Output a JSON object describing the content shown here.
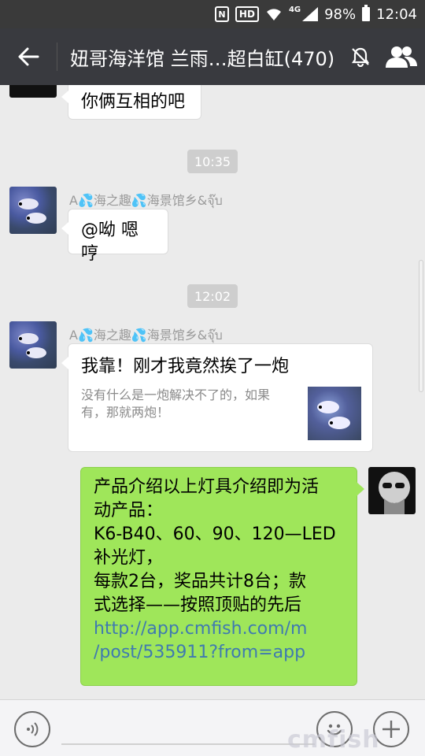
{
  "status_bar": {
    "nfc": "N",
    "hd": "HD",
    "network": "4G",
    "battery": "98%",
    "time": "12:04"
  },
  "header": {
    "title": "妞哥海洋馆 兰雨…超白缸(470)",
    "icons": [
      "back-arrow-icon",
      "mute-bell-icon",
      "members-icon"
    ]
  },
  "messages": [
    {
      "type": "text",
      "side": "left",
      "text": "你俩互相的吧"
    },
    {
      "type": "time",
      "text": "10:35"
    },
    {
      "type": "text",
      "side": "left",
      "sender": "A💦海之趣💦海景馆乡&จุ๊บ",
      "text": "@呦 嗯哼"
    },
    {
      "type": "time",
      "text": "12:02"
    },
    {
      "type": "link",
      "side": "left",
      "sender": "A💦海之趣💦海景馆乡&จุ๊บ",
      "title": "我靠！刚才我竟然挨了一炮",
      "desc_line1": "没有什么是一炮解决不了的，如果",
      "desc_line2": "有，那就两炮！"
    },
    {
      "type": "text",
      "side": "right",
      "lines": [
        "产品介绍以上灯具介绍即为活",
        "动产品：",
        "K6-B40、60、90、120—LED",
        "补光灯，",
        "每款2台，奖品共计8台；款",
        "式选择——按照顶贴的先后"
      ],
      "link_lines": [
        "http://app.cmfish.com/m",
        "/post/535911?from=app"
      ]
    }
  ],
  "input_bar": {
    "icons": [
      "voice-icon",
      "emoji-icon",
      "plus-icon"
    ]
  },
  "watermark": "cmfish",
  "colors": {
    "titlebar": "#393a3f",
    "statusbar": "#3a3a3a",
    "chat_bg": "#ebebeb",
    "self_bubble": "#9fe65a",
    "link": "#3f7ab0"
  }
}
